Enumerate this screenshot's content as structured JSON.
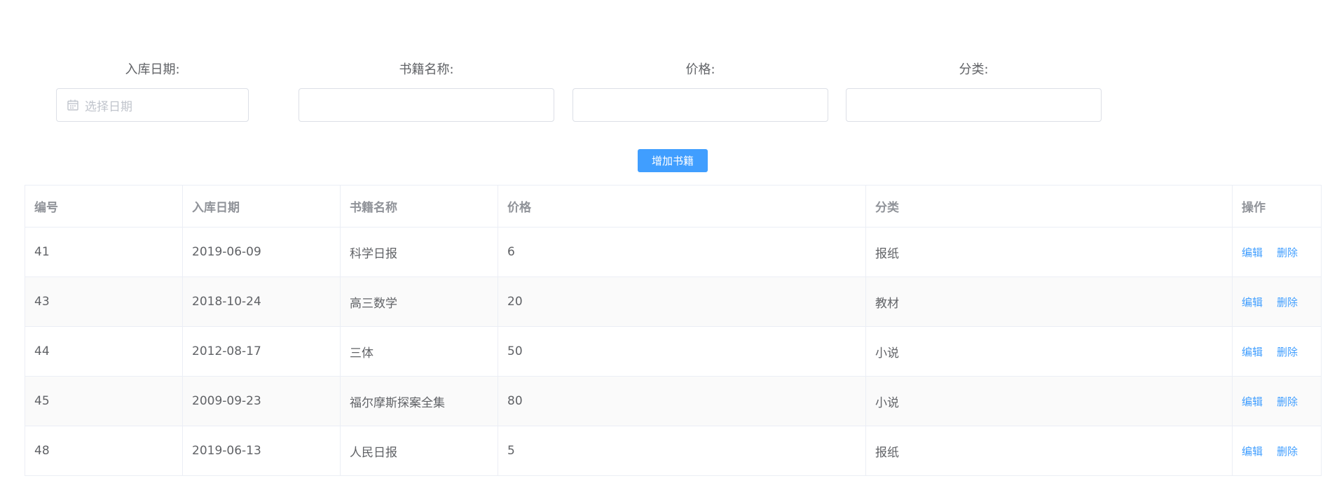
{
  "form": {
    "date_label": "入库日期:",
    "date_placeholder": "选择日期",
    "name_label": "书籍名称:",
    "name_value": "",
    "price_label": "价格:",
    "price_value": "",
    "category_label": "分类:",
    "category_value": "",
    "add_button_label": "增加书籍"
  },
  "table": {
    "headers": [
      "编号",
      "入库日期",
      "书籍名称",
      "价格",
      "分类",
      "操作"
    ],
    "edit_label": "编辑",
    "delete_label": "删除",
    "rows": [
      {
        "id": "41",
        "date": "2019-06-09",
        "name": "科学日报",
        "price": "6",
        "category": "报纸"
      },
      {
        "id": "43",
        "date": "2018-10-24",
        "name": "高三数学",
        "price": "20",
        "category": "教材"
      },
      {
        "id": "44",
        "date": "2012-08-17",
        "name": "三体",
        "price": "50",
        "category": "小说"
      },
      {
        "id": "45",
        "date": "2009-09-23",
        "name": "福尔摩斯探案全集",
        "price": "80",
        "category": "小说"
      },
      {
        "id": "48",
        "date": "2019-06-13",
        "name": "人民日报",
        "price": "5",
        "category": "报纸"
      }
    ]
  },
  "colors": {
    "primary": "#409eff",
    "header_text": "#909399",
    "body_text": "#606266",
    "border": "#ebeef5",
    "stripe": "#fafafa"
  }
}
